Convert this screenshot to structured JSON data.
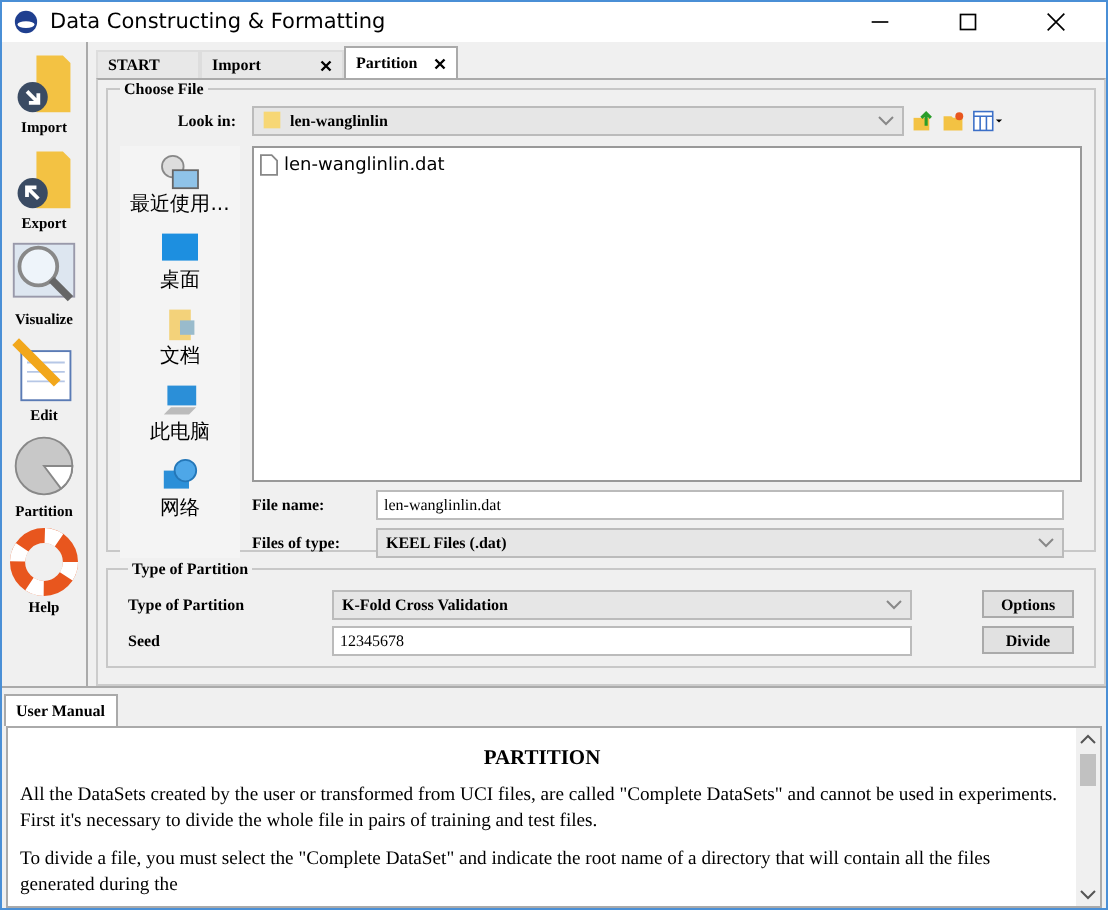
{
  "window": {
    "title": "Data Constructing & Formatting"
  },
  "sidebar": {
    "items": [
      {
        "label": "Import",
        "kind": "import"
      },
      {
        "label": "Export",
        "kind": "export"
      },
      {
        "label": "Visualize",
        "kind": "visualize"
      },
      {
        "label": "Edit",
        "kind": "edit"
      },
      {
        "label": "Partition",
        "kind": "partition"
      },
      {
        "label": "Help",
        "kind": "help"
      }
    ]
  },
  "tabs": [
    {
      "label": "START",
      "closable": false,
      "selected": false
    },
    {
      "label": "Import",
      "closable": true,
      "selected": false
    },
    {
      "label": "Partition",
      "closable": true,
      "selected": true
    }
  ],
  "chooser": {
    "title": "Choose File",
    "look_in_label": "Look in:",
    "look_in_value": "len-wanglinlin",
    "places": [
      {
        "label": "最近使用...",
        "kind": "recent"
      },
      {
        "label": "桌面",
        "kind": "desktop"
      },
      {
        "label": "文档",
        "kind": "documents"
      },
      {
        "label": "此电脑",
        "kind": "computer"
      },
      {
        "label": "网络",
        "kind": "network"
      }
    ],
    "files": [
      "len-wanglinlin.dat"
    ],
    "file_name_label": "File name:",
    "file_name": "len-wanglinlin.dat",
    "file_type_label": "Files of type:",
    "file_type": "KEEL Files (.dat)"
  },
  "partition": {
    "title": "Type of Partition",
    "type_label": "Type of Partition",
    "type_value": "K-Fold Cross Validation",
    "seed_label": "Seed",
    "seed_value": "12345678",
    "buttons": [
      "Options",
      "Divide"
    ]
  },
  "manual": {
    "tab": "User Manual",
    "heading": "PARTITION",
    "paragraphs": [
      "All the DataSets created by the user or transformed from UCI files, are called \"Complete DataSets\" and cannot be used in experiments. First it's necessary to divide the whole file in pairs of training and test files.",
      "To divide a file, you must select the \"Complete DataSet\" and indicate the root name of a directory that will contain all the files generated during the"
    ]
  }
}
